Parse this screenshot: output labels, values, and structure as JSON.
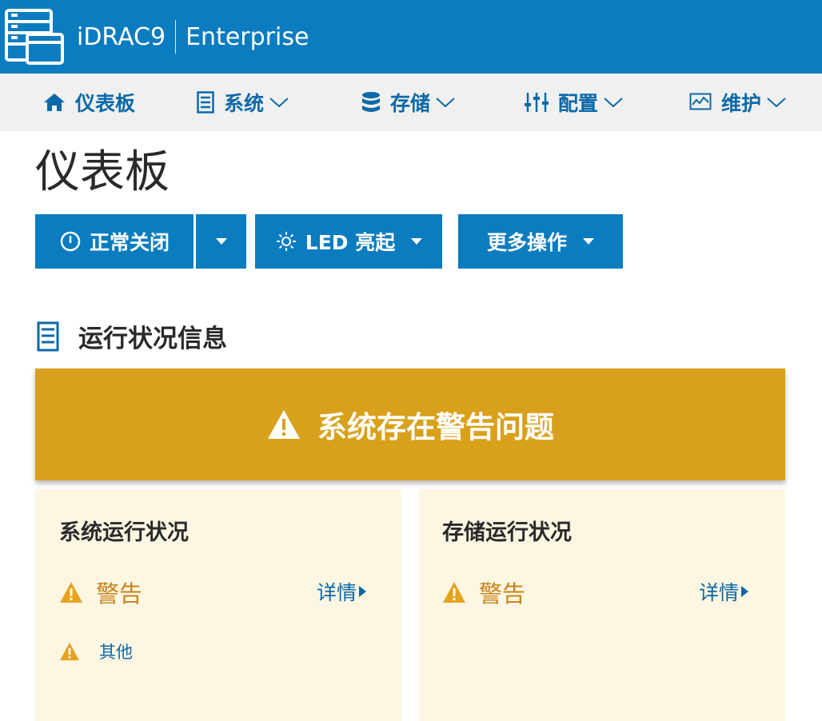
{
  "header": {
    "product": "iDRAC9",
    "edition": "Enterprise"
  },
  "nav": {
    "dashboard": "仪表板",
    "system": "系统",
    "storage": "存储",
    "config": "配置",
    "maintenance": "维护"
  },
  "page": {
    "title": "仪表板"
  },
  "actions": {
    "shutdown": "正常关闭",
    "led": "LED 亮起",
    "more": "更多操作"
  },
  "health": {
    "section_title": "运行状况信息",
    "banner": "系统存在警告问题",
    "system_card": {
      "title": "系统运行状况",
      "status": "警告",
      "details": "详情",
      "sub_items": [
        "其他"
      ]
    },
    "storage_card": {
      "title": "存储运行状况",
      "status": "警告",
      "details": "详情"
    }
  },
  "colors": {
    "brand_blue": "#0b7cbf",
    "nav_text": "#0b69a8",
    "warning_banner": "#d9a11b",
    "warning_text": "#c7841a",
    "card_bg": "#fdf6e3"
  },
  "icons": {
    "logo": "server-window-icon",
    "dashboard": "home-icon",
    "system": "server-icon",
    "storage": "database-icon",
    "config": "sliders-icon",
    "maintenance": "monitor-chart-icon",
    "shutdown": "power-icon",
    "led": "sun-icon",
    "warning": "warning-triangle-icon"
  }
}
